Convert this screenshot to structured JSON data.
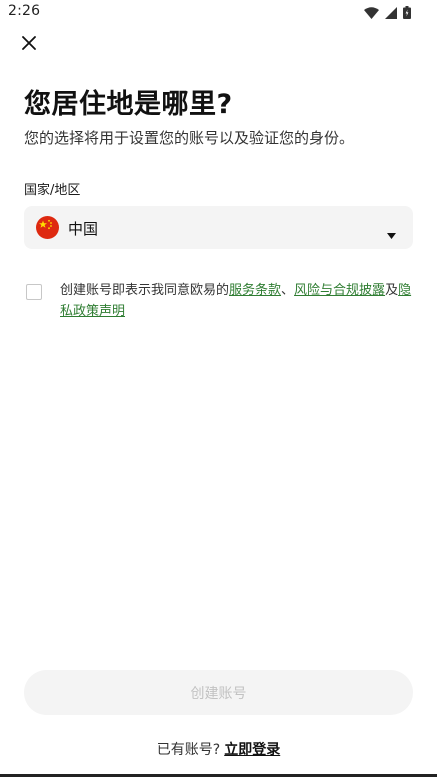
{
  "status_bar": {
    "time": "2:26",
    "icons": [
      "wifi-icon",
      "cell-signal-icon",
      "battery-icon"
    ]
  },
  "header": {
    "close_icon": "close-icon"
  },
  "page": {
    "title": "您居住地是哪里?",
    "subtitle": "您的选择将用于设置您的账号以及验证您的身份。"
  },
  "country_field": {
    "label": "国家/地区",
    "selected_value": "中国",
    "flag_icon": "china-flag-icon",
    "dropdown_icon": "caret-down-icon"
  },
  "consent": {
    "checked": false,
    "text_prefix": "创建账号即表示我同意欧易的",
    "link_terms": "服务条款",
    "separator": "、",
    "link_risk": "风险与合规披露",
    "conjunction": "及",
    "link_privacy": "隐私政策声明"
  },
  "actions": {
    "create_label": "创建账号",
    "login_prompt": "已有账号?",
    "login_link": "立即登录"
  },
  "colors": {
    "link_green": "#2f7d32",
    "input_bg": "#f4f4f4",
    "disabled_text": "#c2c2c2"
  }
}
